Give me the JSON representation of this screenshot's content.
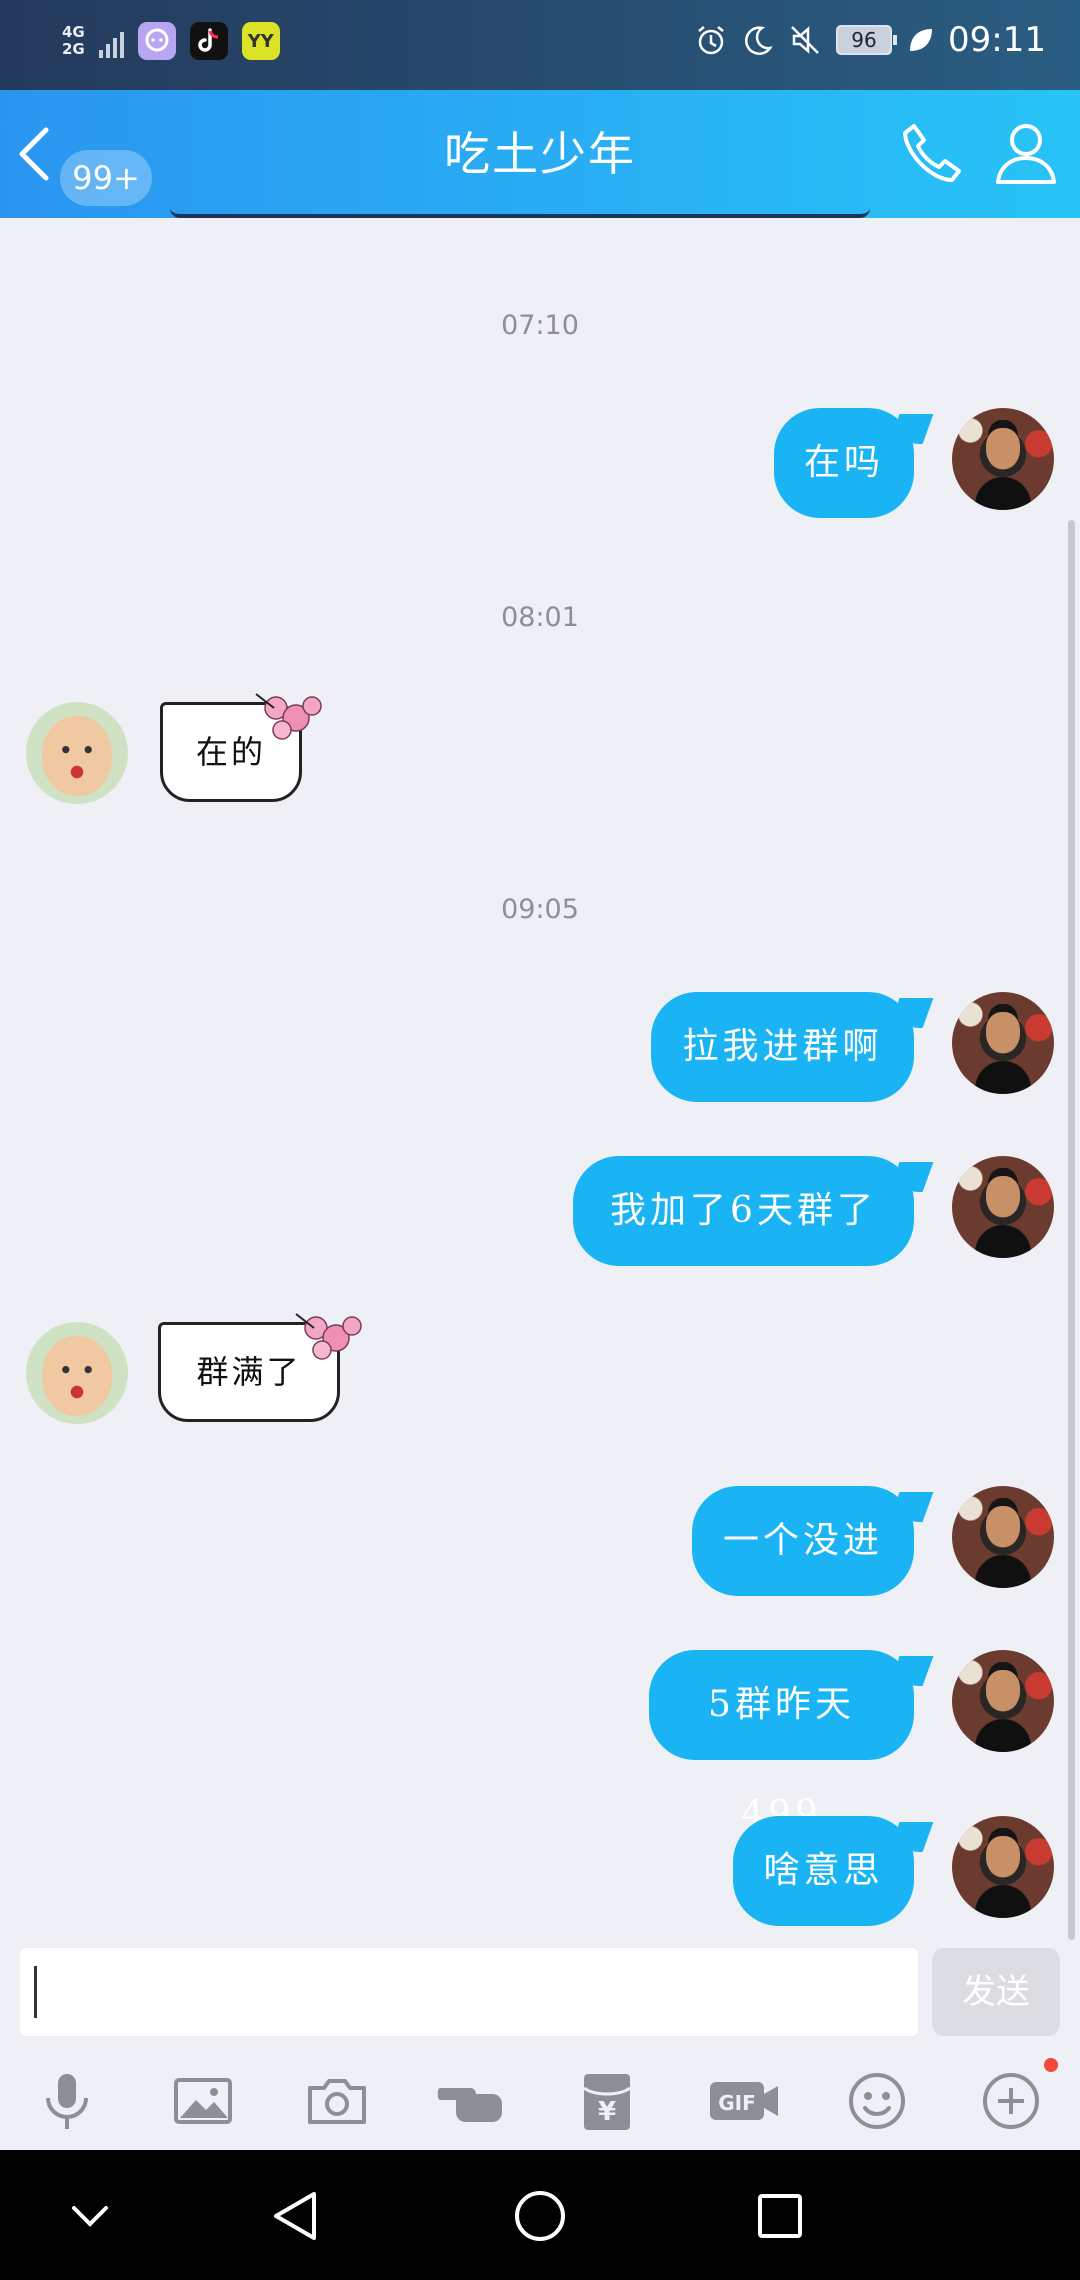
{
  "status": {
    "network_top": "4G",
    "network_bottom": "2G",
    "battery": "96",
    "time": "09:11",
    "app_icons": [
      "chat-app-icon",
      "tiktok-icon",
      "yy-icon"
    ],
    "yy_label": "YY"
  },
  "header": {
    "unread_badge": "99+",
    "title": "吃土少年"
  },
  "messages": [
    {
      "type": "time",
      "text": "07:10"
    },
    {
      "type": "sent",
      "text": "在吗"
    },
    {
      "type": "time",
      "text": "08:01"
    },
    {
      "type": "received",
      "text": "在的"
    },
    {
      "type": "time",
      "text": "09:05"
    },
    {
      "type": "sent",
      "text": "拉我进群啊"
    },
    {
      "type": "sent",
      "text": "我加了6天群了"
    },
    {
      "type": "received",
      "text": "群满了"
    },
    {
      "type": "sent",
      "text": "一个没进"
    },
    {
      "type": "sent",
      "text": "5群昨天499"
    },
    {
      "type": "sent",
      "text": "啥意思"
    }
  ],
  "input": {
    "value": "",
    "send_label": "发送"
  },
  "toolbar": {
    "items": [
      "microphone-icon",
      "image-icon",
      "camera-icon",
      "poke-icon",
      "red-packet-icon",
      "gif-icon",
      "emoji-icon",
      "plus-icon"
    ],
    "gif_label": "GIF",
    "redpacket_label": "¥"
  },
  "colors": {
    "header_start": "#2a95f0",
    "header_end": "#28c4f7",
    "sent_bubble": "#1ab4f5",
    "background": "#eff0f6"
  }
}
